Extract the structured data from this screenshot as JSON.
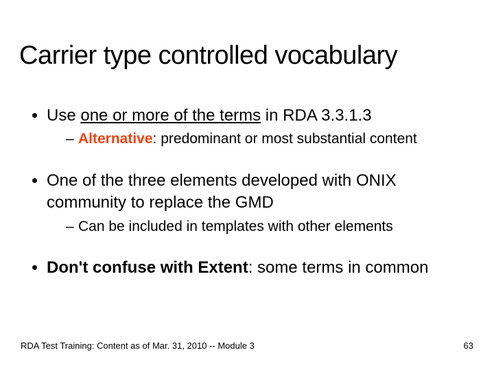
{
  "title": "Carrier type controlled vocabulary",
  "bullets": [
    {
      "lead": "Use ",
      "underline": "one or more of the terms",
      "tail": " in RDA 3.3.1.3",
      "sub": {
        "label": "Alternative",
        "text": ":  predominant or most substantial content"
      }
    },
    {
      "text": "One of the three elements developed with ONIX community to replace the GMD",
      "sub": {
        "text": "Can be included in templates with other elements"
      }
    },
    {
      "bold": "Don't confuse with Extent",
      "tail": ":  some terms in common"
    }
  ],
  "footer": {
    "left": "RDA Test Training:  Content as of Mar. 31, 2010 -- Module 3",
    "right": "63"
  }
}
